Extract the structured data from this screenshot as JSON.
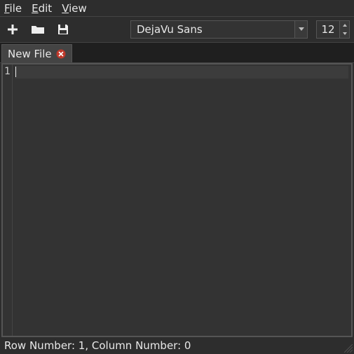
{
  "menubar": {
    "file": {
      "prefix": "F",
      "rest": "ile"
    },
    "edit": {
      "prefix": "E",
      "rest": "dit"
    },
    "view": {
      "prefix": "V",
      "rest": "iew"
    }
  },
  "toolbar": {
    "new_icon": "plus-icon",
    "open_icon": "folder-icon",
    "save_icon": "floppy-icon",
    "font_name": "DejaVu Sans",
    "font_size": "12"
  },
  "tabs": [
    {
      "label": "New File"
    }
  ],
  "editor": {
    "gutter": [
      "1"
    ],
    "content": ""
  },
  "status": {
    "row_label": "Row Number: ",
    "row": "1",
    "sep": ", ",
    "col_label": "Column Number: ",
    "col": "0"
  }
}
